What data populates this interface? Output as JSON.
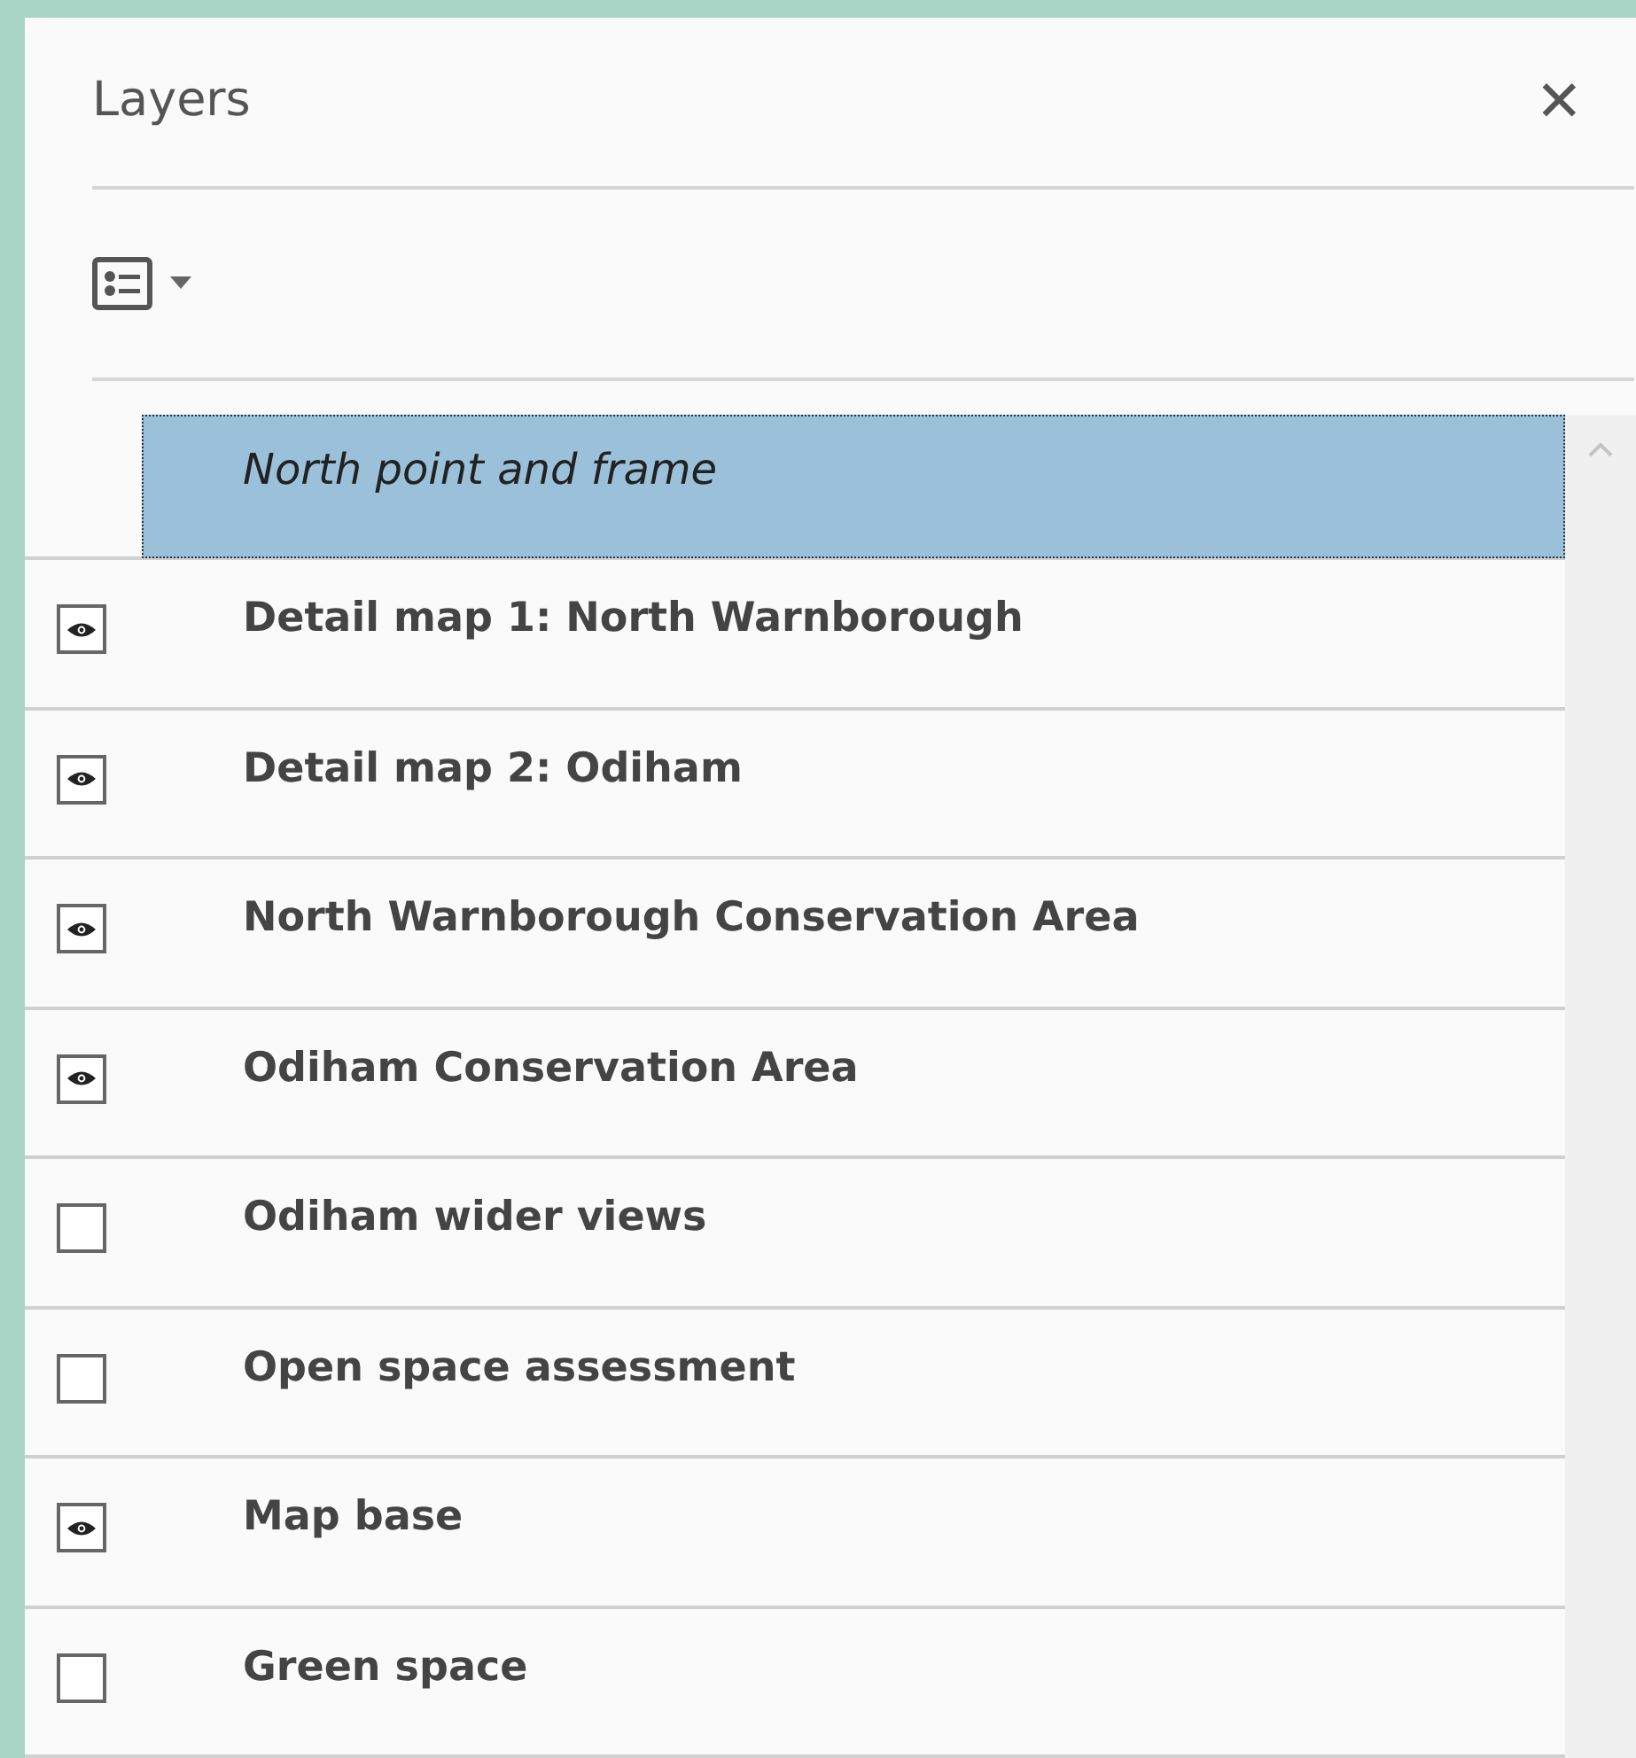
{
  "panel": {
    "title": "Layers",
    "close": "✕"
  },
  "layers": [
    {
      "kind": "title",
      "label": "North point and frame",
      "selected": true
    },
    {
      "kind": "layer",
      "label": "Detail map 1: North Warnborough",
      "visible": true,
      "selected": false
    },
    {
      "kind": "layer",
      "label": "Detail map 2: Odiham",
      "visible": true,
      "selected": false
    },
    {
      "kind": "layer",
      "label": "North Warnborough Conservation Area",
      "visible": true,
      "selected": false
    },
    {
      "kind": "layer",
      "label": "Odiham Conservation Area",
      "visible": true,
      "selected": false
    },
    {
      "kind": "layer",
      "label": "Odiham wider views",
      "visible": false,
      "selected": false
    },
    {
      "kind": "layer",
      "label": "Open space assessment",
      "visible": false,
      "selected": false
    },
    {
      "kind": "layer",
      "label": "Map base",
      "visible": true,
      "selected": false
    },
    {
      "kind": "layer",
      "label": "Green space",
      "visible": false,
      "selected": false
    }
  ]
}
